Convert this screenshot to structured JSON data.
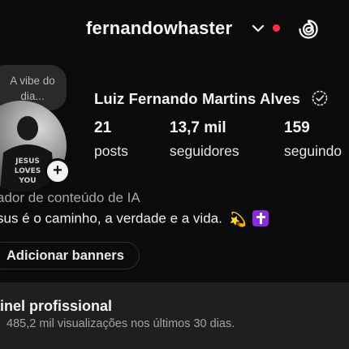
{
  "header": {
    "username": "fernandowhaster",
    "notification_color": "#ff3040",
    "icons": [
      "chevron-down-icon",
      "threads-icon"
    ]
  },
  "note": {
    "text_line1": "A vibe do",
    "text_line2": "dia..."
  },
  "profile": {
    "full_name": "Luiz Fernando Martins Alves",
    "verified_icon": "verified-badge-icon",
    "avatar_text": "JESUS LOVES YOU"
  },
  "stats": [
    {
      "value": "21",
      "label": "posts"
    },
    {
      "value": "13,7 mil",
      "label": "seguidores"
    },
    {
      "value": "159",
      "label": "seguindo"
    }
  ],
  "bio": {
    "category": "ador de conteúdo de IA",
    "text": "sus é o caminho, a verdade e a vida.",
    "emoji_star": "💫",
    "accent": "#8a2be2"
  },
  "buttons": {
    "banners": "Adicionar banners"
  },
  "dashboard": {
    "title": "ainel profissional",
    "subtitle": "485,2 mil visualizações nos últimos 30 dias."
  }
}
